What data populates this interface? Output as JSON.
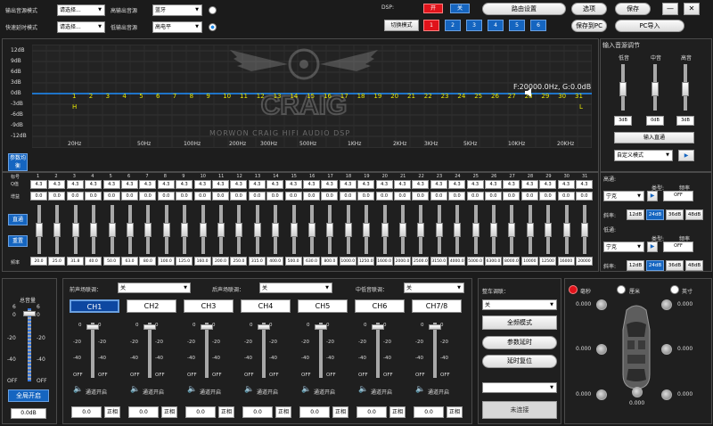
{
  "top": {
    "output_source_mode_label": "输出音源模式",
    "quick_delay_mode_label": "快速延时模式",
    "output_source_select": "请选择...",
    "quick_delay_select": "请选择...",
    "hi_level_label": "高输出音源",
    "lo_level_label": "低输出音源",
    "hi_level_select": "蓝牙",
    "lo_level_select": "高电平",
    "dsp_label": "DSP:",
    "dsp_on": "开",
    "dsp_off": "关",
    "switch_mode": "切换模式",
    "modes": [
      "1",
      "2",
      "3",
      "4",
      "5",
      "6"
    ],
    "route_settings": "路由设置",
    "options": "选项",
    "save": "保存",
    "save_to_pc": "保存到PC",
    "pc_import": "PC导入",
    "minimize": "—",
    "close": "✕"
  },
  "eq_graph": {
    "y_ticks": [
      "12dB",
      "9dB",
      "6dB",
      "3dB",
      "0dB",
      "-3dB",
      "-6dB",
      "-9dB",
      "-12dB"
    ],
    "x_ticks": [
      "20Hz",
      "50Hz",
      "100Hz",
      "200Hz",
      "300Hz",
      "500Hz",
      "1KHz",
      "2KHz",
      "3KHz",
      "5KHz",
      "10KHz",
      "20KHz"
    ],
    "band_numbers": [
      "1",
      "2",
      "3",
      "4",
      "5",
      "6",
      "7",
      "8",
      "9",
      "10",
      "11",
      "12",
      "13",
      "14",
      "15",
      "16",
      "17",
      "18",
      "19",
      "20",
      "21",
      "22",
      "23",
      "24",
      "25",
      "26",
      "27",
      "28",
      "29",
      "30",
      "31"
    ],
    "h_marker": "H",
    "l_marker": "L",
    "readout": "F:20000.0Hz, G:0.0dB",
    "watermark_logo": "CRAIG",
    "watermark_sub": "MORWON CRAIG HIFI AUDIO DSP"
  },
  "input_gain": {
    "title": "输入音源调节",
    "bass_label": "低音",
    "mid_label": "中音",
    "treble_label": "高音",
    "bass_value": "3dB",
    "mid_value": "0dB",
    "treble_value": "3dB",
    "direct_button": "输入直通",
    "mode_select": "自定义模式"
  },
  "bands": {
    "param_eq_button": "参数均衡",
    "row_label_band": "标号",
    "row_label_q": "Q值",
    "row_label_gain": "增益",
    "row_label_freq": "频率",
    "q_values": [
      "4.3",
      "4.3",
      "4.3",
      "4.3",
      "4.3",
      "4.3",
      "4.3",
      "4.3",
      "4.3",
      "4.3",
      "4.3",
      "4.3",
      "4.3",
      "4.3",
      "4.3",
      "4.3",
      "4.3",
      "4.3",
      "4.3",
      "4.3",
      "4.3",
      "4.3",
      "4.3",
      "4.3",
      "4.3",
      "4.3",
      "4.3",
      "4.3",
      "4.3",
      "4.3",
      "4.3"
    ],
    "gain_values": [
      "0.0",
      "0.0",
      "0.0",
      "0.0",
      "0.0",
      "0.0",
      "0.0",
      "0.0",
      "0.0",
      "0.0",
      "0.0",
      "0.0",
      "0.0",
      "0.0",
      "0.0",
      "0.0",
      "0.0",
      "0.0",
      "0.0",
      "0.0",
      "0.0",
      "0.0",
      "0.0",
      "0.0",
      "0.0",
      "0.0",
      "0.0",
      "0.0",
      "0.0",
      "0.0",
      "0.0"
    ],
    "freq_values": [
      "20.0",
      "25.0",
      "31.8",
      "40.0",
      "50.0",
      "63.0",
      "80.0",
      "100.0",
      "125.0",
      "160.0",
      "200.0",
      "250.0",
      "315.0",
      "400.0",
      "500.0",
      "630.0",
      "800.0",
      "1000.0",
      "1250.0",
      "1600.0",
      "2000.0",
      "2500.0",
      "3150.0",
      "4000.0",
      "5000.0",
      "6300.0",
      "8000.0",
      "10000",
      "12500",
      "16000",
      "20000"
    ],
    "bypass_button": "直通",
    "reset_button": "重置"
  },
  "hpf": {
    "title": "高通:",
    "type_label": "类型:",
    "freq_label": "频率",
    "type_select": "宁克",
    "freq_value": "OFF",
    "slope_label": "斜率:",
    "slopes": [
      "12dB",
      "24dB",
      "36dB",
      "48dB"
    ]
  },
  "lpf": {
    "title": "低通:",
    "type_label": "类型:",
    "freq_label": "频率",
    "type_select": "宁克",
    "freq_value": "OFF",
    "slope_label": "斜率:",
    "slopes": [
      "12dB",
      "24dB",
      "36dB",
      "48dB"
    ]
  },
  "master": {
    "title": "总音量",
    "scale_left": [
      "6",
      "0",
      "-20",
      "-40",
      "OFF"
    ],
    "scale_right": [
      "6",
      "0",
      "-20",
      "-40",
      "OFF"
    ],
    "all_on_button": "全局开启",
    "value": "0.0dB"
  },
  "channels": {
    "front_link_label": "前声场联调：",
    "rear_link_label": "后声场联调：",
    "center_link_label": "中低音联调：",
    "front_link_select": "关",
    "rear_link_select": "关",
    "center_link_select": "关",
    "tabs": [
      "CH1",
      "CH2",
      "CH3",
      "CH4",
      "CH5",
      "CH6",
      "CH7/8"
    ],
    "scale": [
      "0",
      "-20",
      "-40",
      "OFF"
    ],
    "channel_on_label": "通道开启",
    "value": "0.0",
    "phase_label": "正相"
  },
  "car_link": {
    "title": "整车调联：",
    "select": "关",
    "full_band_mode": "全频模式",
    "param_delay": "参数延时",
    "delay_reset": "延时复位",
    "bottom_select": "",
    "disconnected": "未连接"
  },
  "delay": {
    "unit_ms": "毫秒",
    "unit_cm": "厘米",
    "unit_inch": "英寸",
    "values": [
      "0.000",
      "0.000",
      "0.000",
      "0.000",
      "0.000",
      "0.000",
      "0.000"
    ]
  },
  "colors": {
    "graph_line": "#1e90ff",
    "band_label": "#e8e800",
    "active_blue": "#1565c0",
    "red": "#e0131b"
  }
}
